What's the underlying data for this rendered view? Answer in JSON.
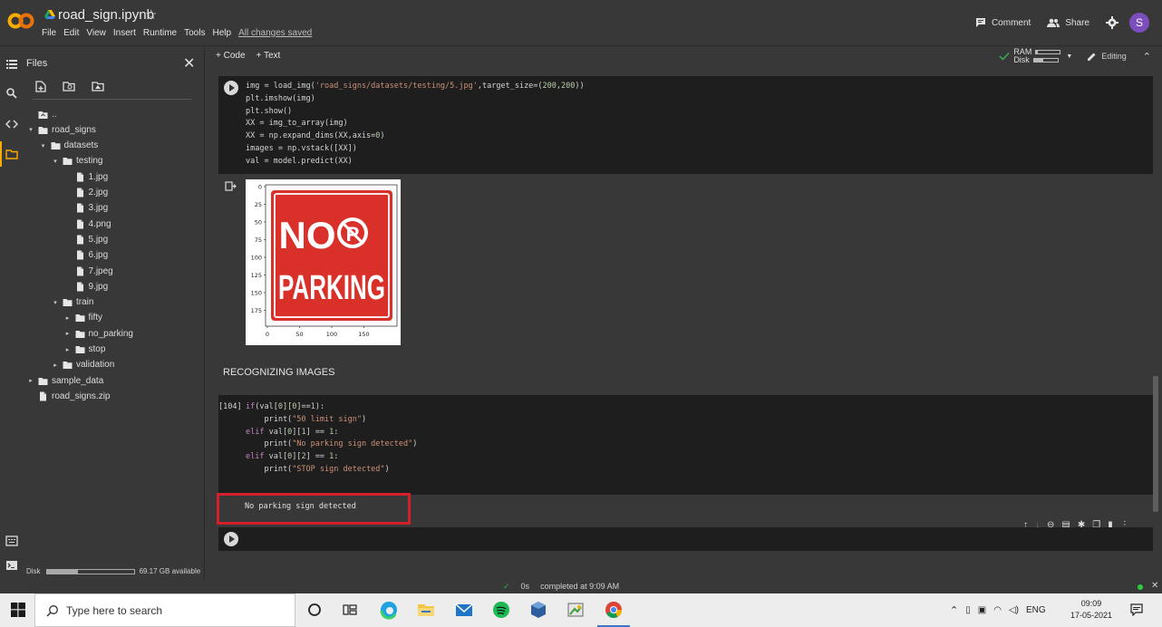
{
  "app": {
    "title": "road_sign.ipynb",
    "menu": [
      "File",
      "Edit",
      "View",
      "Insert",
      "Runtime",
      "Tools",
      "Help"
    ],
    "save_status": "All changes saved",
    "comment_label": "Comment",
    "share_label": "Share",
    "avatar_letter": "S"
  },
  "files_panel": {
    "title": "Files",
    "tree": [
      {
        "label": "..",
        "type": "folder-up",
        "depth": 0,
        "arrow": ""
      },
      {
        "label": "road_signs",
        "type": "folder",
        "depth": 0,
        "arrow": "▾"
      },
      {
        "label": "datasets",
        "type": "folder",
        "depth": 1,
        "arrow": "▾"
      },
      {
        "label": "testing",
        "type": "folder",
        "depth": 2,
        "arrow": "▾"
      },
      {
        "label": "1.jpg",
        "type": "file",
        "depth": 3,
        "arrow": ""
      },
      {
        "label": "2.jpg",
        "type": "file",
        "depth": 3,
        "arrow": ""
      },
      {
        "label": "3.jpg",
        "type": "file",
        "depth": 3,
        "arrow": ""
      },
      {
        "label": "4.png",
        "type": "file",
        "depth": 3,
        "arrow": ""
      },
      {
        "label": "5.jpg",
        "type": "file",
        "depth": 3,
        "arrow": ""
      },
      {
        "label": "6.jpg",
        "type": "file",
        "depth": 3,
        "arrow": ""
      },
      {
        "label": "7.jpeg",
        "type": "file",
        "depth": 3,
        "arrow": ""
      },
      {
        "label": "9.jpg",
        "type": "file",
        "depth": 3,
        "arrow": ""
      },
      {
        "label": "train",
        "type": "folder",
        "depth": 2,
        "arrow": "▾"
      },
      {
        "label": "fifty",
        "type": "folder",
        "depth": 3,
        "arrow": "▸"
      },
      {
        "label": "no_parking",
        "type": "folder",
        "depth": 3,
        "arrow": "▸"
      },
      {
        "label": "stop",
        "type": "folder",
        "depth": 3,
        "arrow": "▸"
      },
      {
        "label": "validation",
        "type": "folder",
        "depth": 2,
        "arrow": "▸"
      },
      {
        "label": "sample_data",
        "type": "folder",
        "depth": 0,
        "arrow": "▸"
      },
      {
        "label": "road_signs.zip",
        "type": "file",
        "depth": 0,
        "arrow": ""
      }
    ],
    "disk_label": "Disk",
    "disk_available": "69.17 GB available",
    "disk_used_fraction": 0.36
  },
  "notebook": {
    "add_code": "+ Code",
    "add_text": "+ Text",
    "ram_label": "RAM",
    "disk_label": "Disk",
    "ram_fraction": 0.08,
    "disk_fraction": 0.4,
    "editing_label": "Editing",
    "cell1_lines": [
      "img = load_img('road_signs/datasets/testing/5.jpg',target_size=(200,200))",
      "plt.imshow(img)",
      "plt.show()",
      "XX = img_to_array(img)",
      "XX = np.expand_dims(XX,axis=0)",
      "images = np.vstack([XX])",
      "val = model.predict(XX)"
    ],
    "plot": {
      "sign_line1": "NO",
      "sign_line2": "PARKING",
      "sign_symbol": "P",
      "y_ticks": [
        "0",
        "25",
        "50",
        "75",
        "100",
        "125",
        "150",
        "175"
      ],
      "x_ticks": [
        "0",
        "50",
        "100",
        "150"
      ]
    },
    "section_heading": "RECOGNIZING IMAGES",
    "cell2_prompt": "[104]",
    "cell2_lines": [
      "if(val[0][0]==1):",
      "    print(\"50 limit sign\")",
      "elif val[0][1] == 1:",
      "    print(\"No parking sign detected\")",
      "elif val[0][2] == 1:",
      "    print(\"STOP sign detected\")"
    ],
    "output_text": "No parking sign detected"
  },
  "status_bar": {
    "duration": "0s",
    "completed": "completed at 9:09 AM"
  },
  "taskbar": {
    "search_placeholder": "Type here to search",
    "language": "ENG",
    "time": "09:09",
    "date": "17-05-2021"
  },
  "colors": {
    "background": "#383838",
    "cell": "#1e1e1e",
    "highlight": "#d3202a",
    "sign_red": "#d9302a"
  }
}
